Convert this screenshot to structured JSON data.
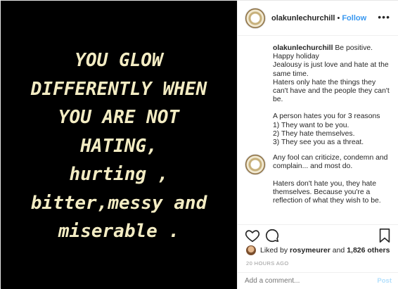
{
  "image_quote": {
    "lines": [
      "YOU GLOW",
      "DIFFERENTLY WHEN",
      "YOU ARE NOT",
      "HATING,",
      "hurting ,",
      "bitter,messy and",
      "miserable ."
    ]
  },
  "header": {
    "username": "olakunlechurchill",
    "separator": "•",
    "follow_label": "Follow",
    "more_icon": "more-horizontal-icon",
    "more_label": "•••"
  },
  "caption": {
    "username": "olakunlechurchill",
    "paragraphs": [
      [
        "Be positive. Happy holiday",
        "Jealousy is just love and hate at the same time.",
        "Haters only hate the things they can't have and the people they can't be."
      ],
      [
        "A person hates you for 3 reasons",
        "1) They want to be you.",
        "2) They hate themselves.",
        "3) They see you as a threat."
      ]
    ]
  },
  "comment": {
    "paragraphs": [
      [
        "Any fool can criticize, condemn and complain... and most do."
      ],
      [
        "Haters don't hate you, they hate themselves. Because you're a reflection of what they wish to be."
      ]
    ]
  },
  "actions": {
    "icons": [
      "heart-icon",
      "comment-icon",
      "bookmark-icon"
    ]
  },
  "likes": {
    "prefix": "Liked by",
    "user": "rosymeurer",
    "conjunction": "and",
    "others": "1,826 others"
  },
  "timestamp": "20 HOURS AGO",
  "add_comment": {
    "placeholder": "Add a comment...",
    "post_label": "Post"
  }
}
